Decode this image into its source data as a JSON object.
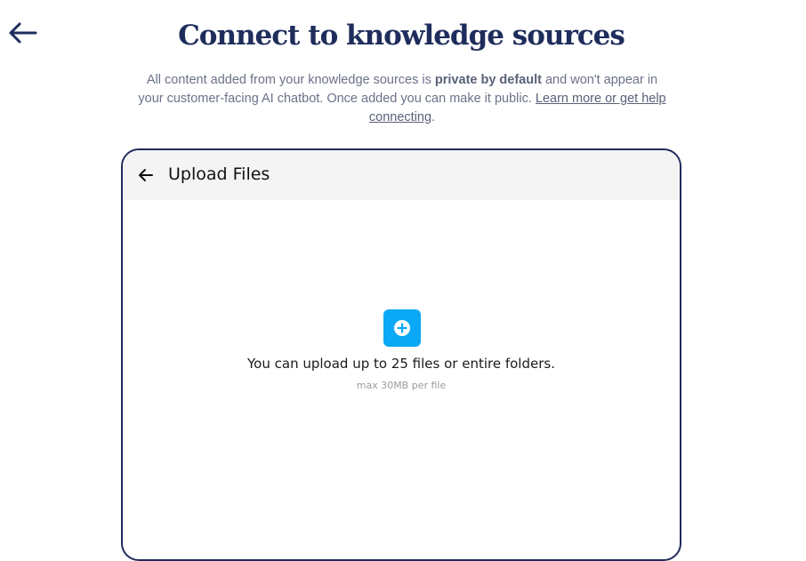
{
  "page": {
    "title": "Connect to knowledge sources",
    "subtitle_part1": "All content added from your knowledge sources is ",
    "subtitle_bold": "private by default",
    "subtitle_part2": " and won't appear in your customer-facing AI chatbot. Once added you can make it public. ",
    "help_link": "Learn more or get help connecting",
    "subtitle_end": "."
  },
  "icons": {
    "back": "arrow-left-icon",
    "card_back": "arrow-left-icon",
    "add": "plus-circle-icon"
  },
  "card": {
    "title": "Upload Files",
    "upload_text": "You can upload up to 25 files or entire folders.",
    "upload_limit": "max 30MB per file"
  },
  "colors": {
    "title": "#1e2d5c",
    "card_border": "#1f2a5a",
    "accent": "#0aa8f5",
    "header_bg": "#f4f4f4"
  }
}
